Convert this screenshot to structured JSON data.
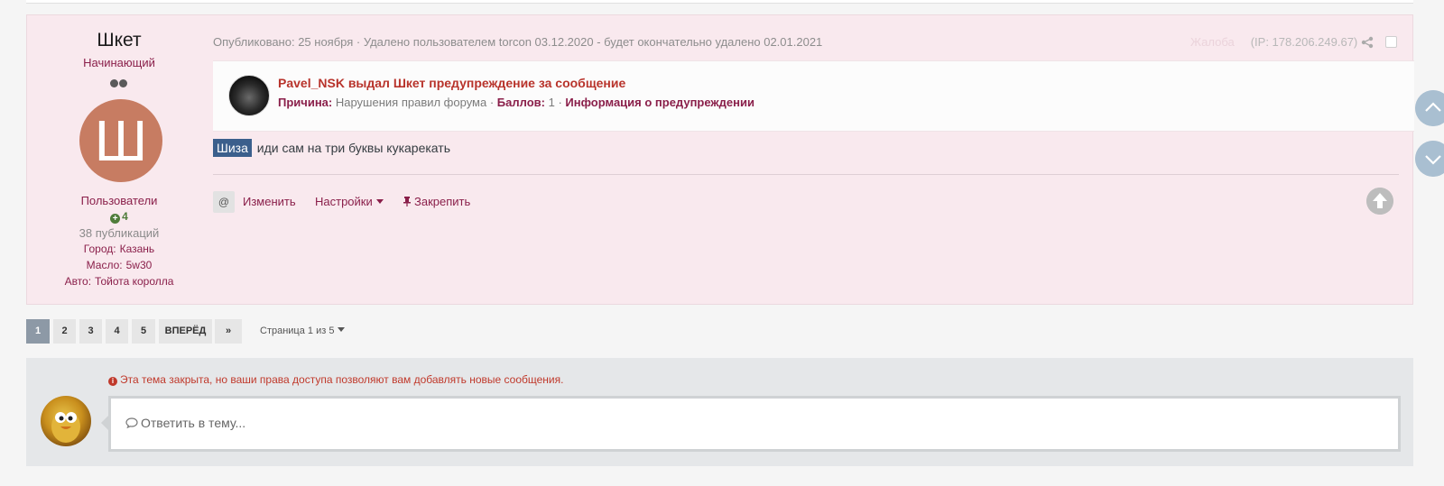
{
  "post": {
    "author": {
      "name": "Шкет",
      "rank": "Начинающий",
      "avatar_letter": "Ш",
      "avatar_color": "#c77c62",
      "group": "Пользователи",
      "reputation": "4",
      "post_count": "38 публикаций",
      "fields": [
        {
          "label": "Город:",
          "value": "Казань"
        },
        {
          "label": "Масло:",
          "value": "5w30"
        },
        {
          "label": "Авто:",
          "value": "Тойота королла"
        }
      ]
    },
    "meta": "Опубликовано: 25 ноября · Удалено пользователем torcon 03.12.2020 - будет окончательно удалено 02.01.2021",
    "meta_faded": "Жалоба",
    "ip": "(IP: 178.206.249.67)",
    "warning": {
      "title": "Pavel_NSK выдал Шкет предупреждение за сообщение",
      "reason_label": "Причина:",
      "reason": "Нарушения правил форума",
      "points_label": "Баллов:",
      "points": "1",
      "info_link": "Информация о предупреждении"
    },
    "body": {
      "tag": "Шиза",
      "text": "иди сам на три буквы кукарекать"
    },
    "actions": {
      "mention": "@",
      "edit": "Изменить",
      "settings": "Настройки",
      "pin": "Закрепить"
    }
  },
  "pagination": {
    "pages": [
      "1",
      "2",
      "3",
      "4",
      "5"
    ],
    "active": "1",
    "next": "ВПЕРЁД",
    "last": "»",
    "info": "Страница 1 из 5"
  },
  "reply": {
    "closed_notice": "Эта тема закрыта, но ваши права доступа позволяют вам добавлять новые сообщения.",
    "placeholder": "Ответить в тему..."
  },
  "colors": {
    "accent": "#8a1f4a",
    "post_bg": "#f9e9ee",
    "tag_bg": "#3b5f8c",
    "warning_red": "#b8332b"
  }
}
